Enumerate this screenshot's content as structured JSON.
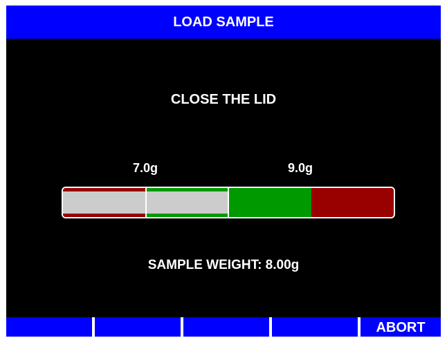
{
  "title": "LOAD SAMPLE",
  "instruction": "CLOSE THE LID",
  "limits": {
    "low": "7.0g",
    "high": "9.0g"
  },
  "weight_gauge": {
    "range_min_g": 6.0,
    "range_max_g": 10.0,
    "low_limit_g": 7.0,
    "high_limit_g": 9.0,
    "current_g": 8.0,
    "colors": {
      "out_of_range": "#990000",
      "in_range": "#009900",
      "fill": "#cccccc",
      "outline": "#ffffff"
    }
  },
  "weight_readout": "SAMPLE WEIGHT: 8.00g",
  "softkeys": [
    {
      "label": ""
    },
    {
      "label": ""
    },
    {
      "label": ""
    },
    {
      "label": ""
    },
    {
      "label": "ABORT"
    }
  ],
  "colors": {
    "title_bar": "#0000ff",
    "background": "#000000",
    "text": "#ffffff"
  }
}
